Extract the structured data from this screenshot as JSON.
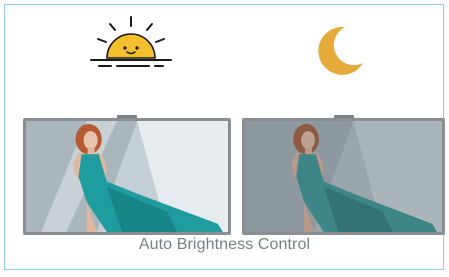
{
  "caption": "Auto Brightness Control",
  "icons": {
    "day": "sun-icon",
    "night": "moon-icon"
  },
  "colors": {
    "border": "#8fd0e6",
    "sun": "#f5c02e",
    "moon": "#e6aa3a",
    "caption": "#7a7f86",
    "dress": "#1f9c9e",
    "tv_frame": "#8a8f94"
  },
  "screens": [
    {
      "id": "bright-screen"
    },
    {
      "id": "dim-screen"
    }
  ]
}
